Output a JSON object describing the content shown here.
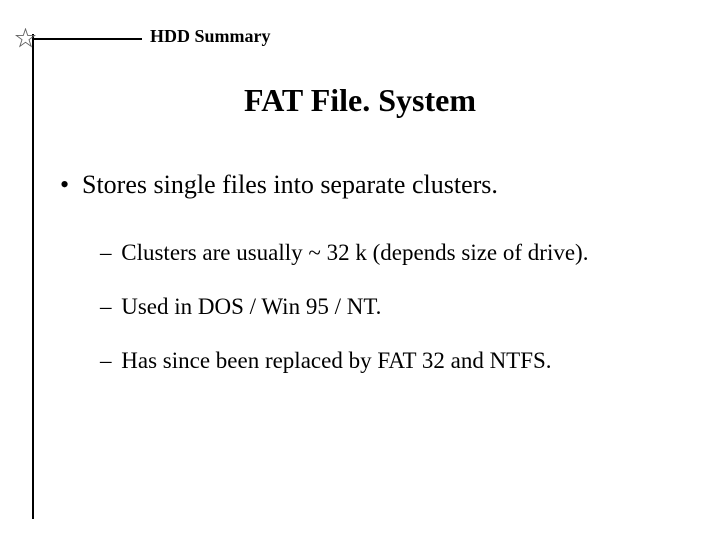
{
  "header": {
    "label": "HDD Summary"
  },
  "title": "FAT File. System",
  "bullets": {
    "b1": "Stores single files into separate clusters.",
    "b1_1": "Clusters are usually ~ 32 k (depends size of drive).",
    "b1_2": "Used in DOS / Win 95 / NT.",
    "b1_3": "Has since been replaced by FAT 32 and NTFS."
  },
  "glyphs": {
    "dot": "•",
    "dash": "–"
  }
}
